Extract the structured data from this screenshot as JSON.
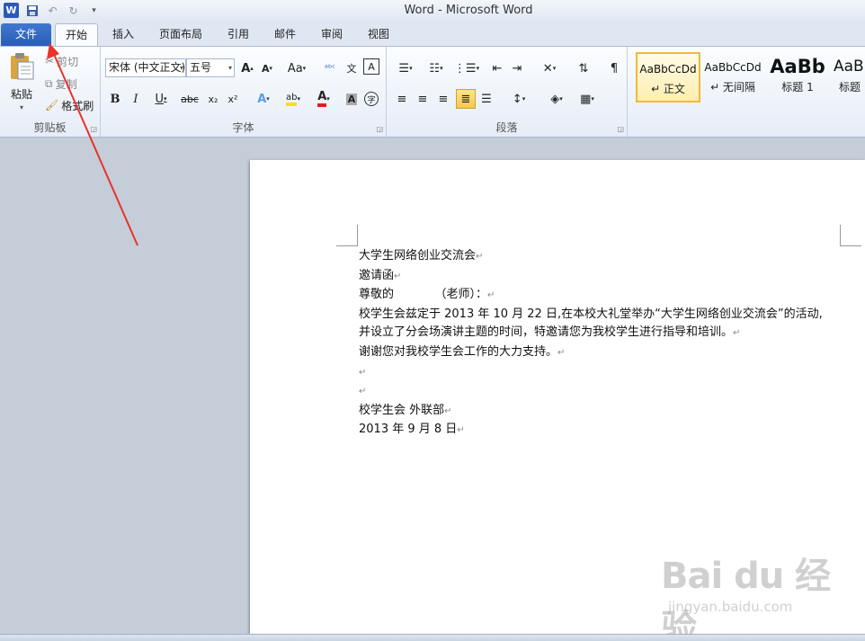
{
  "window": {
    "title": "Word  -  Microsoft Word"
  },
  "quick_access": {
    "word_logo": "W"
  },
  "tabs": [
    {
      "label": "文件"
    },
    {
      "label": "开始"
    },
    {
      "label": "插入"
    },
    {
      "label": "页面布局"
    },
    {
      "label": "引用"
    },
    {
      "label": "邮件"
    },
    {
      "label": "审阅"
    },
    {
      "label": "视图"
    }
  ],
  "clipboard": {
    "paste": "粘贴",
    "cut": "剪切",
    "copy": "复制",
    "format_painter": "格式刷",
    "group": "剪贴板"
  },
  "font": {
    "name": "宋体 (中文正文)",
    "size": "五号",
    "group": "字体",
    "change_case": "Aa",
    "font_color": "A",
    "clear": "A"
  },
  "paragraph": {
    "group": "段落"
  },
  "styles": [
    {
      "sample": "AaBbCcDd",
      "name": "↵ 正文"
    },
    {
      "sample": "AaBbCcDd",
      "name": "↵ 无间隔"
    },
    {
      "sample": "AaBb",
      "name": "标题 1"
    },
    {
      "sample": "AaBb",
      "name": "标题"
    }
  ],
  "document": {
    "lines": [
      "大学生网络创业交流会",
      "邀请函",
      "尊敬的           （老师）：",
      "校学生会兹定于 2013 年 10 月 22 日,在本校大礼堂举办“大学生网络创业交流会”的活动,",
      "并设立了分会场演讲主题的时间，特邀请您为我校学生进行指导和培训。",
      "谢谢您对我校学生会工作的大力支持。",
      "",
      "",
      "校学生会 外联部",
      "2013 年 9 月 8 日"
    ],
    "para_marks": [
      true,
      true,
      true,
      false,
      true,
      true,
      true,
      true,
      true,
      true
    ]
  },
  "watermark": {
    "logo": "Bai du 经验",
    "url": "jingyan.baidu.com"
  },
  "colors": {
    "file_tab": "#2a5db5",
    "arrow": "#e8332a",
    "selected_style": "#f0b93c"
  }
}
